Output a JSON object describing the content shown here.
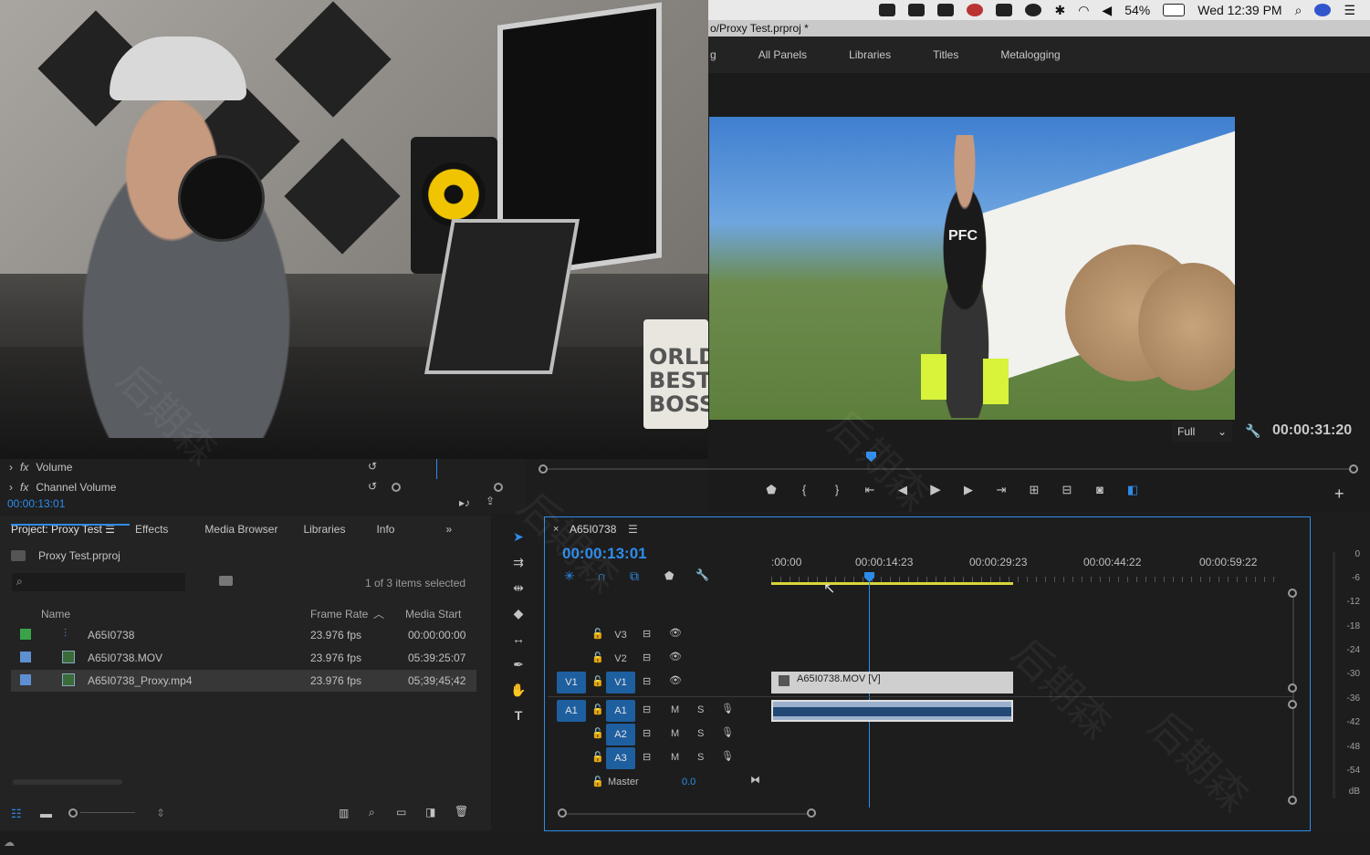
{
  "menubar": {
    "battery": "54%",
    "clock": "Wed 12:39 PM"
  },
  "window": {
    "title": "o/Proxy Test.prproj *"
  },
  "workspaces": [
    "g",
    "All Panels",
    "Libraries",
    "Titles",
    "Metalogging"
  ],
  "photo": {
    "mug_text": "ORLD\nBEST\nBOSS"
  },
  "program_monitor": {
    "resolution": "Full",
    "timecode": "00:00:31:20",
    "video_text": "PFC"
  },
  "effect_controls": {
    "rows": [
      {
        "label": "Volume"
      },
      {
        "label": "Channel Volume"
      }
    ],
    "timecode": "00:00:13:01"
  },
  "project_panel": {
    "tabs": [
      "Project: Proxy Test",
      "Effects",
      "Media Browser",
      "Libraries",
      "Info"
    ],
    "project_file": "Proxy Test.prproj",
    "selection_status": "1 of 3 items selected",
    "columns": [
      "Name",
      "Frame Rate",
      "Media Start"
    ],
    "rows": [
      {
        "name": "A65I0738",
        "frame_rate": "23.976 fps",
        "media_start": "00:00:00:00",
        "color": "#3aa34a"
      },
      {
        "name": "A65I0738.MOV",
        "frame_rate": "23.976 fps",
        "media_start": "05:39:25:07",
        "color": "#5d8fd1"
      },
      {
        "name": "A65I0738_Proxy.mp4",
        "frame_rate": "23.976 fps",
        "media_start": "05;39;45;42",
        "color": "#5d8fd1"
      }
    ]
  },
  "timeline": {
    "sequence": "A65I0738",
    "timecode": "00:00:13:01",
    "ruler": [
      ":00:00",
      "00:00:14:23",
      "00:00:29:23",
      "00:00:44:22",
      "00:00:59:22"
    ],
    "video_tracks": [
      "V3",
      "V2",
      "V1"
    ],
    "audio_tracks": [
      "A1",
      "A2",
      "A3"
    ],
    "source_v": "V1",
    "source_a": "A1",
    "master_label": "Master",
    "master_value": "0.0",
    "clip_video_label": "A65I0738.MOV [V]",
    "mute_label": "M",
    "solo_label": "S"
  },
  "meters": {
    "scale": [
      "0",
      "-6",
      "-12",
      "-18",
      "-24",
      "-30",
      "-36",
      "-42",
      "-48",
      "-54",
      "dB"
    ]
  },
  "watermark": "后期森"
}
